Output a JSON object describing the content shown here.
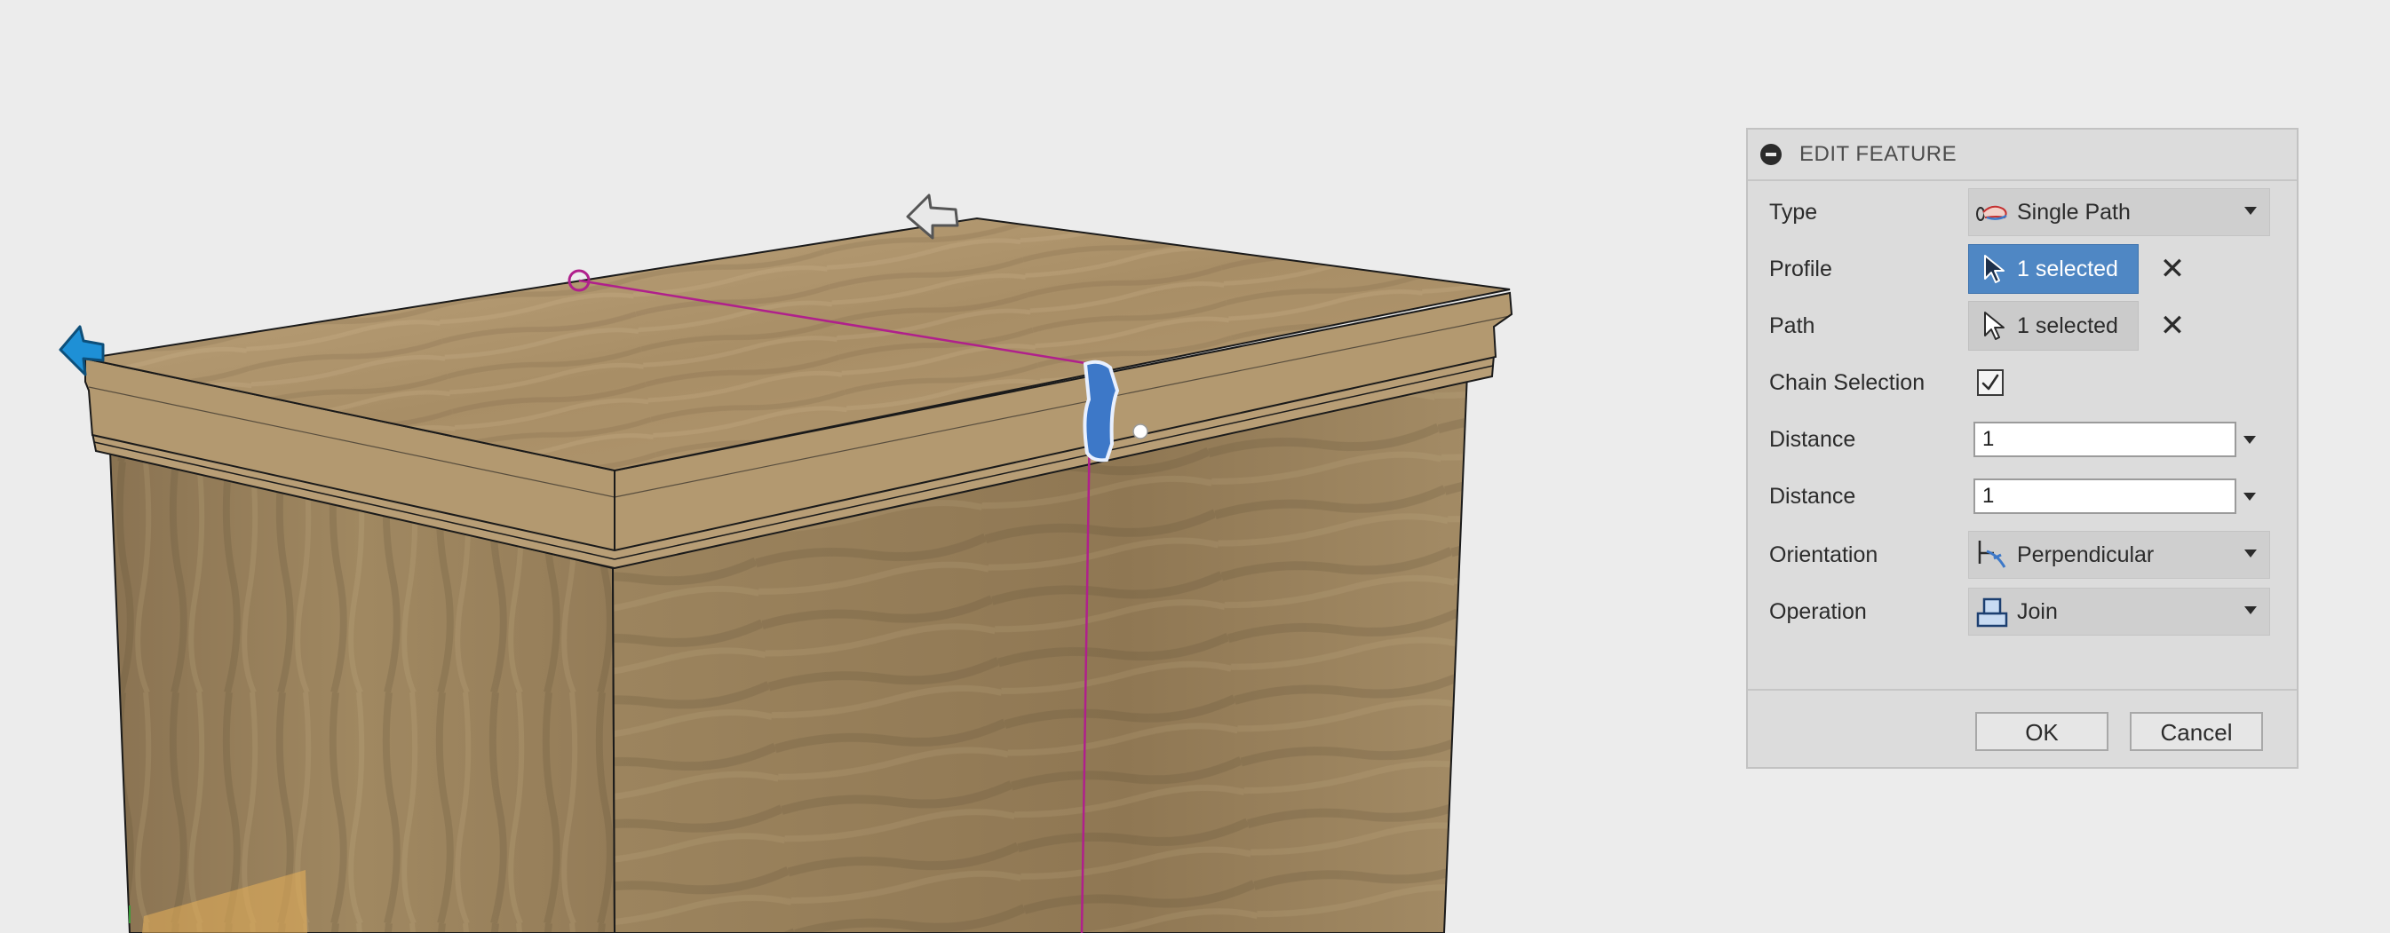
{
  "panel": {
    "title": "EDIT FEATURE",
    "rows": {
      "type": {
        "label": "Type",
        "value": "Single Path",
        "icon": "single-path-icon"
      },
      "profile": {
        "label": "Profile",
        "value": "1 selected",
        "icon": "cursor-arrow-icon"
      },
      "path": {
        "label": "Path",
        "value": "1 selected",
        "icon": "cursor-arrow-icon"
      },
      "chain": {
        "label": "Chain Selection",
        "checked": true
      },
      "distance1": {
        "label": "Distance",
        "value": "1"
      },
      "distance2": {
        "label": "Distance",
        "value": "1"
      },
      "orientation": {
        "label": "Orientation",
        "value": "Perpendicular",
        "icon": "perpendicular-icon"
      },
      "operation": {
        "label": "Operation",
        "value": "Join",
        "icon": "join-icon"
      }
    },
    "ok_label": "OK",
    "cancel_label": "Cancel"
  },
  "colors": {
    "background": "#ececec",
    "selection_blue": "#4f87c4",
    "path_magenta": "#b0208c",
    "wood": "#a88e66"
  }
}
